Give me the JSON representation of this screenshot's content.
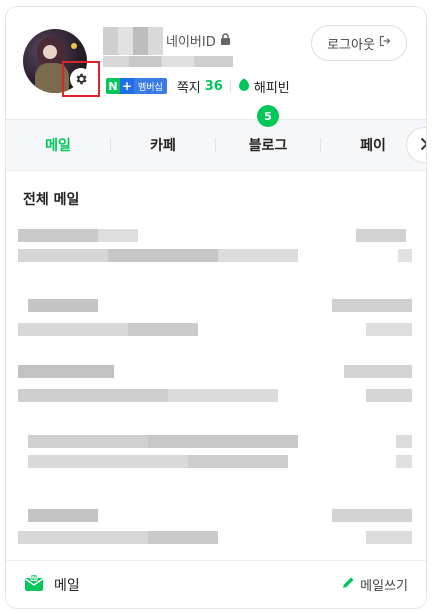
{
  "profile": {
    "naver_id_label": "네이버ID",
    "logout_label": "로그아웃",
    "membership_badge_n": "N",
    "membership_badge_plus": "+",
    "membership_badge_label": "멤버십",
    "memo_label": "쪽지",
    "memo_count": "36",
    "happybean_label": "해피빈"
  },
  "tabs": {
    "items": [
      {
        "label": "메일",
        "active": true
      },
      {
        "label": "카페",
        "active": false
      },
      {
        "label": "블로그",
        "active": false
      },
      {
        "label": "페이",
        "active": false
      }
    ],
    "blog_badge": "5"
  },
  "mail": {
    "section_title": "전체 메일"
  },
  "footer": {
    "mail_label": "메일",
    "write_label": "메일쓰기"
  },
  "colors": {
    "accent_green": "#03c75a",
    "badge_blue": "#1e6ee8",
    "highlight_red": "#d9262a"
  },
  "icons": {
    "settings": "gear-icon",
    "lock": "lock-icon",
    "logout": "logout-icon",
    "happybean": "happybean-icon",
    "next": "chevron-right-icon",
    "mail": "mail-icon",
    "write": "pencil-icon"
  }
}
